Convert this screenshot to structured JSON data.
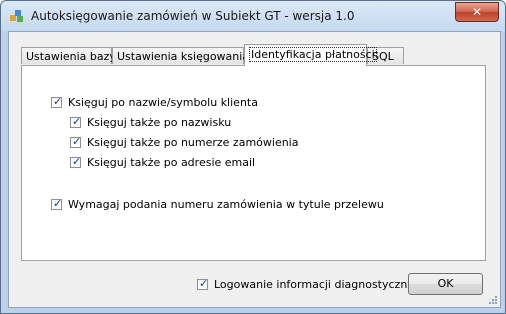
{
  "window": {
    "title": "Autoksięgowanie zamówień w Subiekt GT - wersja 1.0",
    "close_label": "✕",
    "icon": "app-icon"
  },
  "tabs": [
    {
      "label": "Ustawienia bazy",
      "active": false
    },
    {
      "label": "Ustawienia księgowania",
      "active": false
    },
    {
      "label": "Identyfikacja płatności",
      "active": true
    },
    {
      "label": "SQL",
      "active": false
    }
  ],
  "panel": {
    "book_by_name": {
      "label": "Księguj po nazwie/symbolu klienta",
      "checked": true
    },
    "book_by_surname": {
      "label": "Księguj także po nazwisku",
      "checked": true
    },
    "book_by_order_number": {
      "label": "Księguj także po numerze zamówienia",
      "checked": true
    },
    "book_by_email": {
      "label": "Księguj także po adresie email",
      "checked": true
    },
    "require_order_number": {
      "label": "Wymagaj podania numeru zamówienia w tytule przelewu",
      "checked": true
    }
  },
  "footer": {
    "diagnostic_logging": {
      "label": "Logowanie informacji diagnostycznych",
      "checked": true
    },
    "ok_label": "OK"
  },
  "colors": {
    "checkmark": "#1d3b8a",
    "titlebar": "#c6d9ef",
    "close_button": "#c1432b"
  }
}
